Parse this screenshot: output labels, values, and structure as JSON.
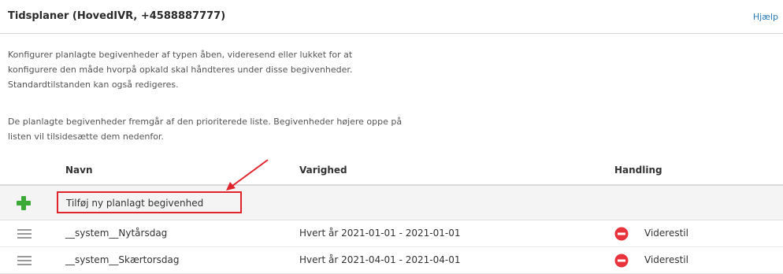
{
  "header": {
    "title": "Tidsplaner (HovedIVR, +4588887777)",
    "help": "Hjælp"
  },
  "description": {
    "paragraph1": [
      "Konfigurer planlagte begivenheder af typen åben, videresend eller lukket for at",
      "konfigurere den måde hvorpå opkald skal håndteres under disse begivenheder.",
      "Standardtilstanden kan også redigeres."
    ],
    "paragraph2": [
      "De planlagte begivenheder fremgår af den prioriterede liste. Begivenheder højere oppe på",
      "listen vil tilsidesætte dem nedenfor."
    ]
  },
  "table": {
    "columns": {
      "name": "Navn",
      "duration": "Varighed",
      "action": "Handling"
    },
    "add_label": "Tilføj ny planlagt begivenhed",
    "rows": [
      {
        "name": "__system__Nytårsdag",
        "duration": "Hvert år 2021-01-01 - 2021-01-01",
        "action": "Viderestil"
      },
      {
        "name": "__system__Skærtorsdag",
        "duration": "Hvert år 2021-04-01 - 2021-04-01",
        "action": "Viderestil"
      }
    ]
  },
  "icons": {
    "add": "plus-icon",
    "drag": "drag-handle-icon",
    "action": "no-entry-icon",
    "annotation": "red-arrow"
  },
  "colors": {
    "link": "#2a7ab8",
    "add_green": "#3aa935",
    "action_red": "#e8323c",
    "highlight_red": "#e0242c"
  }
}
